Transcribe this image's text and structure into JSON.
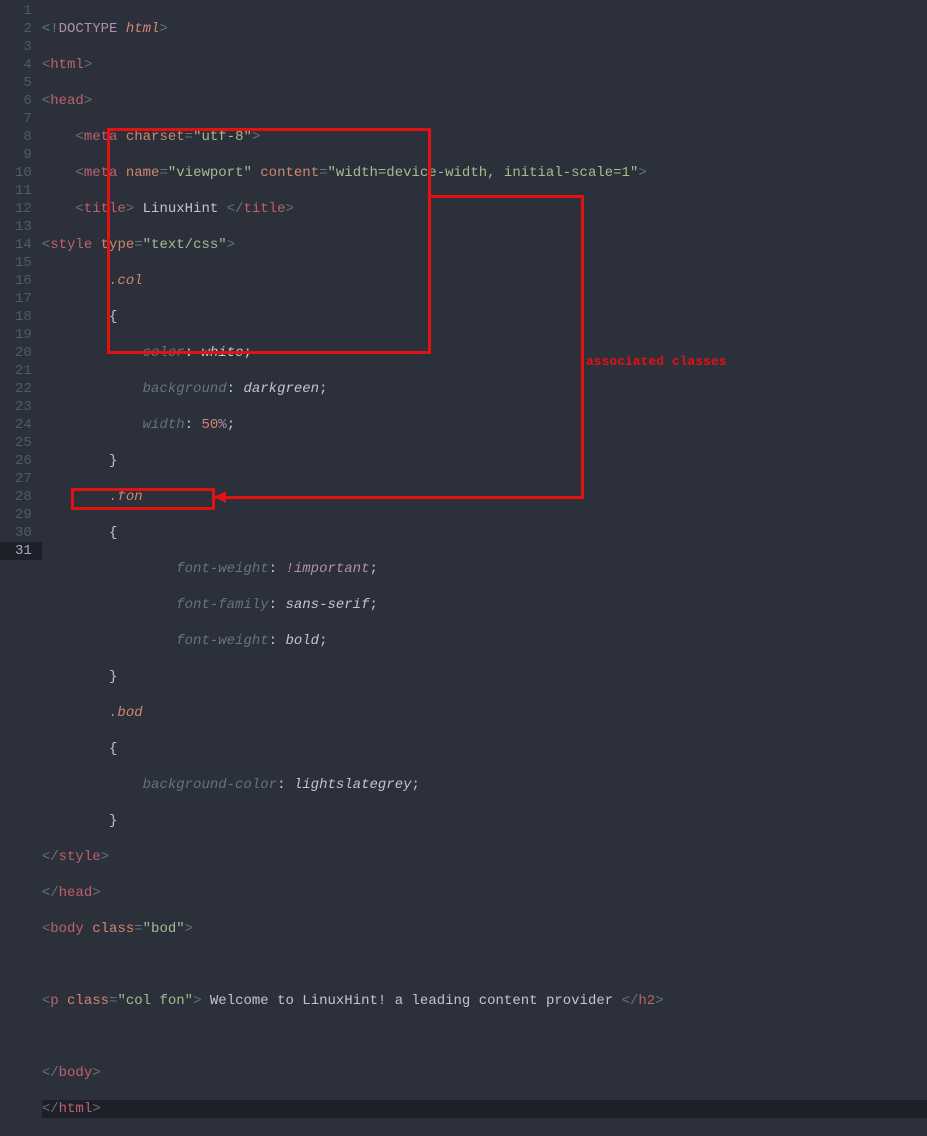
{
  "annotation": "associated classes",
  "gutter": [
    "1",
    "2",
    "3",
    "4",
    "5",
    "6",
    "7",
    "8",
    "9",
    "10",
    "11",
    "12",
    "13",
    "14",
    "15",
    "16",
    "17",
    "18",
    "19",
    "20",
    "21",
    "22",
    "23",
    "24",
    "25",
    "26",
    "27",
    "28",
    "29",
    "30",
    "31"
  ],
  "current_line_index": 30,
  "lines": {
    "l1_doctype_open": "<!",
    "l1_doctype_kw": "DOCTYPE",
    "l1_doctype_attr": "html",
    "l1_doctype_close": ">",
    "l2_open": "<",
    "l2_tag": "html",
    "l2_close": ">",
    "l3_open": "<",
    "l3_tag": "head",
    "l3_close": ">",
    "l4_indent": "    ",
    "l4_open": "<",
    "l4_tag": "meta",
    "l4_attr": "charset",
    "l4_eq": "=",
    "l4_val": "\"utf-8\"",
    "l4_close": ">",
    "l5_indent": "    ",
    "l5_open": "<",
    "l5_tag": "meta",
    "l5_attr1": "name",
    "l5_val1": "\"viewport\"",
    "l5_attr2": "content",
    "l5_val2": "\"width=device-width, initial-scale=1\"",
    "l5_close": ">",
    "l6_indent": "    ",
    "l6_open": "<",
    "l6_tag": "title",
    "l6_close1": ">",
    "l6_text": " LinuxHint ",
    "l6_open2": "</",
    "l6_tag2": "title",
    "l6_close2": ">",
    "l7_open": "<",
    "l7_tag": "style",
    "l7_attr": "type",
    "l7_val": "\"text/css\"",
    "l7_close": ">",
    "l8": "        .col",
    "l9": "        {",
    "l10_indent": "            ",
    "l10_prop": "color",
    "l10_colon": ": ",
    "l10_val": "white",
    "l10_semi": ";",
    "l11_indent": "            ",
    "l11_prop": "background",
    "l11_colon": ": ",
    "l11_val": "darkgreen",
    "l11_semi": ";",
    "l12_indent": "            ",
    "l12_prop": "width",
    "l12_colon": ": ",
    "l12_num": "50",
    "l12_unit": "%",
    "l12_semi": ";",
    "l13": "        }",
    "l14": "        .fon",
    "l15": "        {",
    "l16_indent": "                ",
    "l16_prop": "font-weight",
    "l16_colon": ": ",
    "l16_val": "!important",
    "l16_semi": ";",
    "l17_indent": "                ",
    "l17_prop": "font-family",
    "l17_colon": ": ",
    "l17_val": "sans-serif",
    "l17_semi": ";",
    "l18_indent": "                ",
    "l18_prop": "font-weight",
    "l18_colon": ": ",
    "l18_val": "bold",
    "l18_semi": ";",
    "l19": "        }",
    "l20": "        .bod",
    "l21": "        {",
    "l22_indent": "            ",
    "l22_prop": "background-color",
    "l22_colon": ": ",
    "l22_val": "lightslategrey",
    "l22_semi": ";",
    "l23": "        }",
    "l24_open": "</",
    "l24_tag": "style",
    "l24_close": ">",
    "l25_open": "</",
    "l25_tag": "head",
    "l25_close": ">",
    "l26_open": "<",
    "l26_tag": "body",
    "l26_attr": "class",
    "l26_val": "\"bod\"",
    "l26_close": ">",
    "l27": "",
    "l28_open": "<",
    "l28_tag": "p",
    "l28_attr": "class",
    "l28_val": "\"col fon\"",
    "l28_close1": ">",
    "l28_text": " Welcome to LinuxHint! a leading content provider ",
    "l28_open2": "</",
    "l28_tag2": "h2",
    "l28_close2": ">",
    "l29": "",
    "l30_open": "</",
    "l30_tag": "body",
    "l30_close": ">",
    "l31_open": "</",
    "l31_tag": "html",
    "l31_close": ">"
  }
}
